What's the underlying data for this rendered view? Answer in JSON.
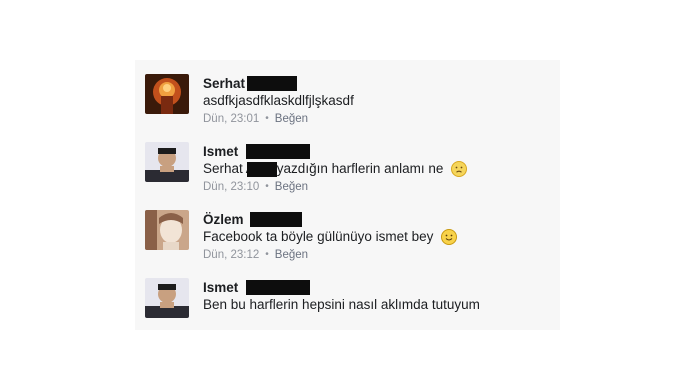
{
  "comments": [
    {
      "name": "Serhat",
      "text": "asdfkjasdfklaskdlfjlşkasdf",
      "time": "Dün, 23:01",
      "like": "Beğen",
      "avatar_colors": [
        "#3a1a0a",
        "#c2501c",
        "#f0a040"
      ]
    },
    {
      "name": "Ismet",
      "text_before": "Serhat A",
      "text_after": " yazdığın harflerin anlamı ne",
      "emoji": "sad-face",
      "time": "Dün, 23:10",
      "like": "Beğen",
      "avatar_colors": [
        "#2b2b33",
        "#c8a080",
        "#e6e6ee"
      ]
    },
    {
      "name": "Özlem",
      "text": "Facebook ta böyle gülünüyo ismet bey",
      "emoji": "smile-face",
      "time": "Dün, 23:12",
      "like": "Beğen",
      "avatar_colors": [
        "#caa68a",
        "#f2e4d6",
        "#8a6048"
      ]
    },
    {
      "name": "Ismet",
      "text": "Ben bu harflerin hepsini nasıl aklımda tutuyum",
      "avatar_colors": [
        "#2b2b33",
        "#c8a080",
        "#e6e6ee"
      ]
    }
  ],
  "colors": {
    "name": "#1c1e21",
    "meta": "#90949c",
    "redaction": "#0d0d0d"
  }
}
